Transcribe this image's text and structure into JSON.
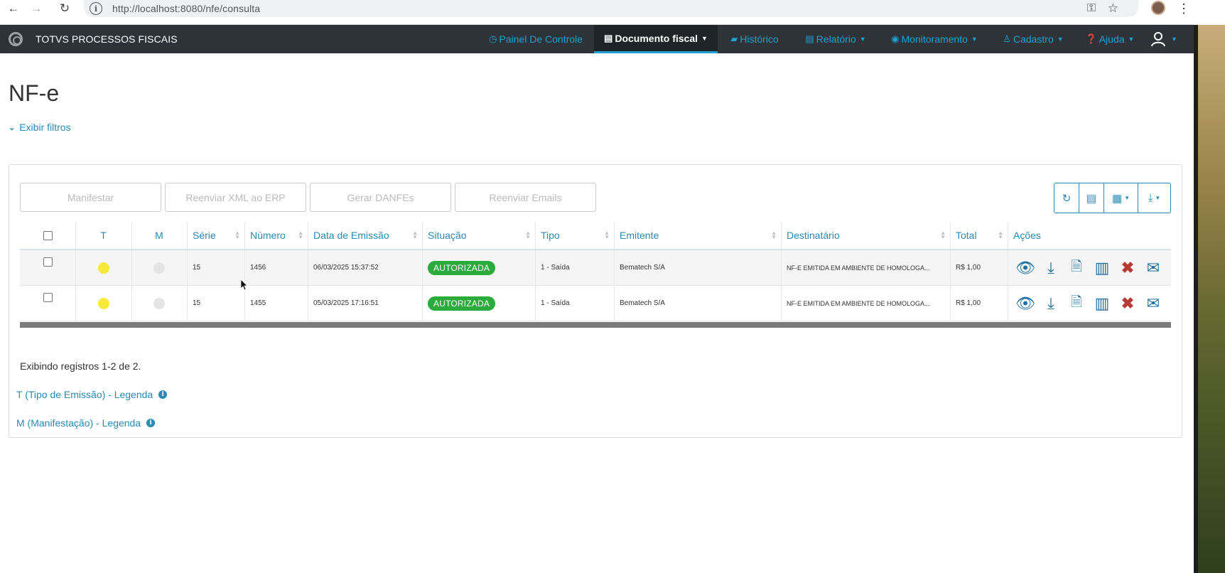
{
  "browser": {
    "url": "http://localhost:8080/nfe/consulta",
    "back_icon": "arrow-left-icon",
    "forward_icon": "arrow-right-icon",
    "reload_icon": "reload-icon"
  },
  "navbar": {
    "brand": "TOTVS PROCESSOS FISCAIS",
    "items": [
      {
        "label": "Painel De Controle",
        "icon": "dashboard-icon"
      },
      {
        "label": "Documento fiscal",
        "icon": "file-icon",
        "active": true
      },
      {
        "label": "Histórico",
        "icon": "folder-icon"
      },
      {
        "label": "Relatório",
        "icon": "list-icon"
      },
      {
        "label": "Monitoramento",
        "icon": "eye-icon"
      },
      {
        "label": "Cadastro",
        "icon": "user-icon"
      },
      {
        "label": "Ajuda",
        "icon": "help-icon"
      }
    ],
    "accent": "#1fa3d1"
  },
  "page": {
    "title": "NF-e",
    "filters_link": "Exibir filtros"
  },
  "toolbar": {
    "manifestar": "Manifestar",
    "reenviar_xml": "Reenviar XML ao ERP",
    "gerar_danfes": "Gerar DANFEs",
    "reenviar_emails": "Reenviar Emails"
  },
  "table": {
    "columns": [
      "T",
      "M",
      "Série",
      "Número",
      "Data de Emissão",
      "Situação",
      "Tipo",
      "Emitente",
      "Destinatário",
      "Total",
      "Ações"
    ],
    "rows": [
      {
        "serie": "15",
        "numero": "1456",
        "data": "06/03/2025 15:37:52",
        "situacao": "AUTORIZADA",
        "tipo": "1 - Saída",
        "emitente": "Bematech S/A",
        "destinatario": "NF-E EMITIDA EM AMBIENTE DE HOMOLOGA...",
        "total": "R$ 1,00"
      },
      {
        "serie": "15",
        "numero": "1455",
        "data": "05/03/2025 17:16:51",
        "situacao": "AUTORIZADA",
        "tipo": "1 - Saída",
        "emitente": "Bematech S/A",
        "destinatario": "NF-E EMITIDA EM AMBIENTE DE HOMOLOGA...",
        "total": "R$ 1,00"
      }
    ],
    "status_color": "#2bab3c"
  },
  "footer": {
    "summary": "Exibindo registros 1-2 de 2.",
    "legend_t": "T (Tipo de Emissão) - Legenda",
    "legend_m": "M (Manifestação) - Legenda"
  }
}
